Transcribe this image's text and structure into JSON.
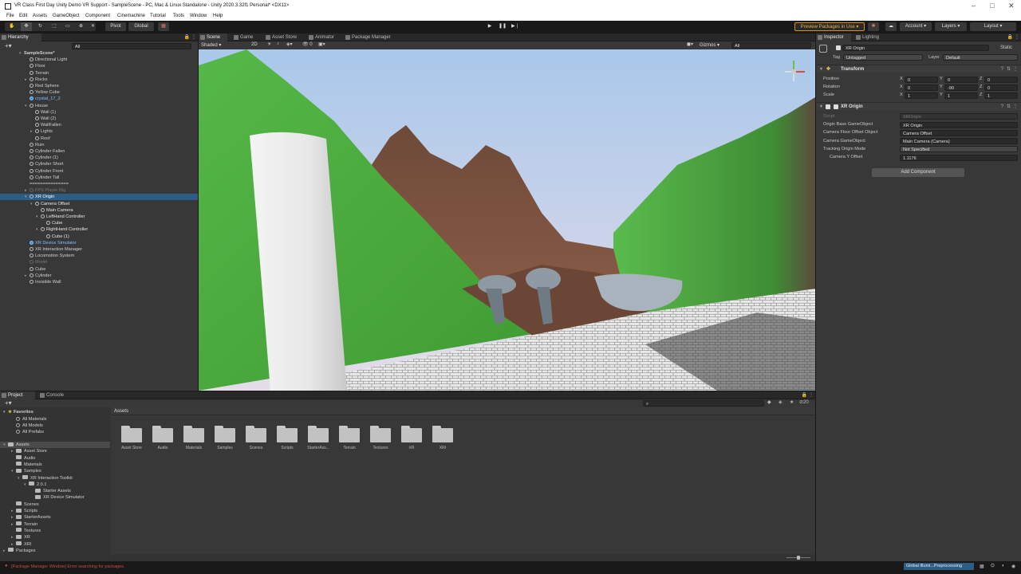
{
  "window": {
    "title": "VR Class First Day Unity Demo VR Support - SampleScene - PC, Mac & Linux Standalone - Unity 2020.3.32f1 Personal* <DX11>"
  },
  "menu": [
    "File",
    "Edit",
    "Assets",
    "GameObject",
    "Component",
    "Cinemachine",
    "Tutorial",
    "Tools",
    "Window",
    "Help"
  ],
  "toolbar": {
    "pivot": "Pivot",
    "global": "Global",
    "preview_packages": "Preview Packages in Use",
    "account": "Account",
    "layers": "Layers",
    "layout": "Layout"
  },
  "hierarchy": {
    "tab": "Hierarchy",
    "search_placeholder": "All",
    "rows": [
      {
        "label": "SampleScene*",
        "kind": "scene"
      },
      {
        "label": "Directional Light"
      },
      {
        "label": "Floor"
      },
      {
        "label": "Terrain"
      },
      {
        "label": "Rocks"
      },
      {
        "label": "Red Sphere"
      },
      {
        "label": "Yellow Cube"
      },
      {
        "label": "crystal_17_2",
        "kind": "blue"
      },
      {
        "label": "House"
      },
      {
        "label": "Wall (1)"
      },
      {
        "label": "Wall (2)"
      },
      {
        "label": "WallFallen"
      },
      {
        "label": "Lights"
      },
      {
        "label": "Roof"
      },
      {
        "label": "Ruin"
      },
      {
        "label": "Cylinder Fallen"
      },
      {
        "label": "Cylinder (1)"
      },
      {
        "label": "Cylinder Short"
      },
      {
        "label": "Cylinder Front"
      },
      {
        "label": "Cylinder Tall"
      },
      {
        "label": "==============="
      },
      {
        "label": "FPS Player Rig",
        "kind": "gray"
      },
      {
        "label": "XR Origin",
        "kind": "sel"
      },
      {
        "label": "Camera Offset",
        "kind": "sub"
      },
      {
        "label": "Main Camera",
        "kind": "sub"
      },
      {
        "label": "LeftHand Controller",
        "kind": "sub"
      },
      {
        "label": "Cube",
        "kind": "sub"
      },
      {
        "label": "RightHand Controller",
        "kind": "sub"
      },
      {
        "label": "Cube (1)",
        "kind": "sub"
      },
      {
        "label": "XR Device Simulator",
        "kind": "blue"
      },
      {
        "label": "XR Interaction Manager"
      },
      {
        "label": "Locomotion System"
      },
      {
        "label": "Model",
        "kind": "gray"
      },
      {
        "label": "Cube"
      },
      {
        "label": "Cylinder"
      },
      {
        "label": "Invisible Wall"
      }
    ]
  },
  "scene_tabs": [
    "Scene",
    "Game",
    "Asset Store",
    "Animator",
    "Package Manager"
  ],
  "scene_toolbar": {
    "shading": "Shaded",
    "mode": "2D",
    "gizmos": "Gizmos",
    "search_placeholder": "All"
  },
  "project": {
    "tabs": [
      "Project",
      "Console"
    ],
    "breadcrumb": "Assets",
    "favorites_label": "Favorites",
    "favorites": [
      "All Materials",
      "All Models",
      "All Prefabs"
    ],
    "tree": [
      "Assets",
      "Asset Store",
      "Audio",
      "Materials",
      "Samples",
      "XR Interaction Toolkit",
      "2.0.1",
      "Starter Assets",
      "XR Device Simulator",
      "Scenes",
      "Scripts",
      "StarterAssets",
      "Terrain",
      "Textures",
      "XR",
      "XRI",
      "Packages"
    ],
    "folders": [
      "Asset Store",
      "Audio",
      "Materials",
      "Samples",
      "Scenes",
      "Scripts",
      "StarterAss...",
      "Terrain",
      "Textures",
      "XR",
      "XRI"
    ],
    "hidden_count": "20"
  },
  "inspector": {
    "tabs": [
      "Inspector",
      "Lighting"
    ],
    "object_name": "XR Origin",
    "static_label": "Static",
    "tag_label": "Tag",
    "tag_value": "Untagged",
    "layer_label": "Layer",
    "layer_value": "Default",
    "transform": {
      "title": "Transform",
      "rows": [
        {
          "label": "Position",
          "x": "0",
          "y": "0",
          "z": "0"
        },
        {
          "label": "Rotation",
          "x": "0",
          "y": "-90",
          "z": "0"
        },
        {
          "label": "Scale",
          "x": "1",
          "y": "1",
          "z": "1"
        }
      ]
    },
    "xr_origin": {
      "title": "XR Origin",
      "script_label": "Script",
      "script_value": "XROrigin",
      "fields": [
        {
          "label": "Origin Base GameObject",
          "value": "XR Origin"
        },
        {
          "label": "Camera Floor Offset Object",
          "value": "Camera Offset"
        },
        {
          "label": "Camera GameObject",
          "value": "Main Camera (Camera)"
        },
        {
          "label": "Tracking Origin Mode",
          "value": "Not Specified"
        },
        {
          "label": "Camera Y Offset",
          "value": "1.1176"
        }
      ]
    },
    "add_component": "Add Component"
  },
  "status": {
    "message": "[Package Manager Window] Error searching for packages.",
    "progress": "Global Illumi...Preprocessing"
  },
  "colors": {
    "selection": "#2c5d87",
    "preview_packages_border": "#d98e1a",
    "error": "#d9443d"
  }
}
